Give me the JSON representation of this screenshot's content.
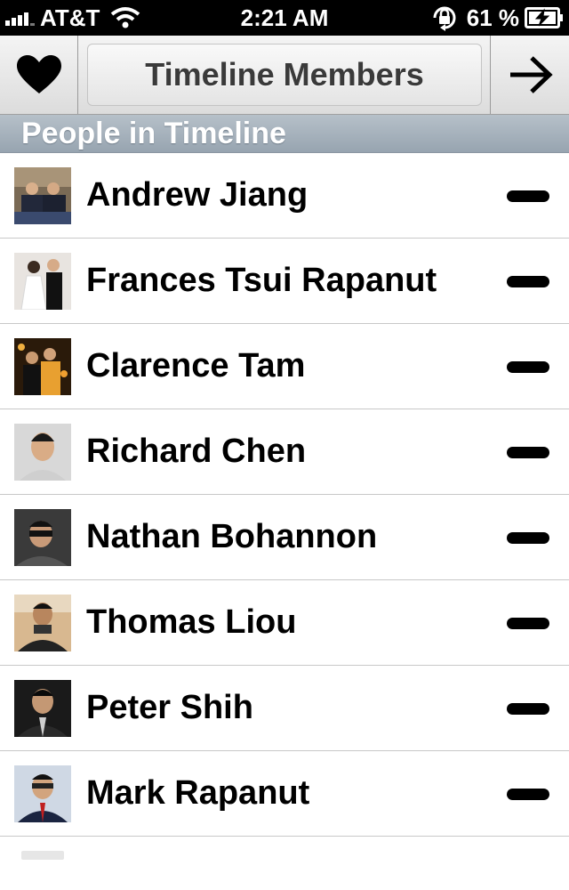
{
  "status_bar": {
    "carrier": "AT&T",
    "time": "2:21 AM",
    "battery": "61 %",
    "icons": [
      "signal-icon",
      "wifi-icon",
      "rotation-lock-icon",
      "battery-charging-icon"
    ]
  },
  "nav": {
    "title": "Timeline Members",
    "left_icon": "heart-icon",
    "right_icon": "arrow-right-icon"
  },
  "section": {
    "title": "People in Timeline"
  },
  "members": [
    {
      "name": "Andrew Jiang"
    },
    {
      "name": "Frances Tsui Rapanut"
    },
    {
      "name": "Clarence Tam"
    },
    {
      "name": "Richard Chen"
    },
    {
      "name": "Nathan Bohannon"
    },
    {
      "name": "Thomas Liou"
    },
    {
      "name": "Peter Shih"
    },
    {
      "name": "Mark Rapanut"
    }
  ],
  "colors": {
    "section_header": "#a7b2bc",
    "nav_background": "#e6e6e6",
    "status_bar": "#000000"
  }
}
